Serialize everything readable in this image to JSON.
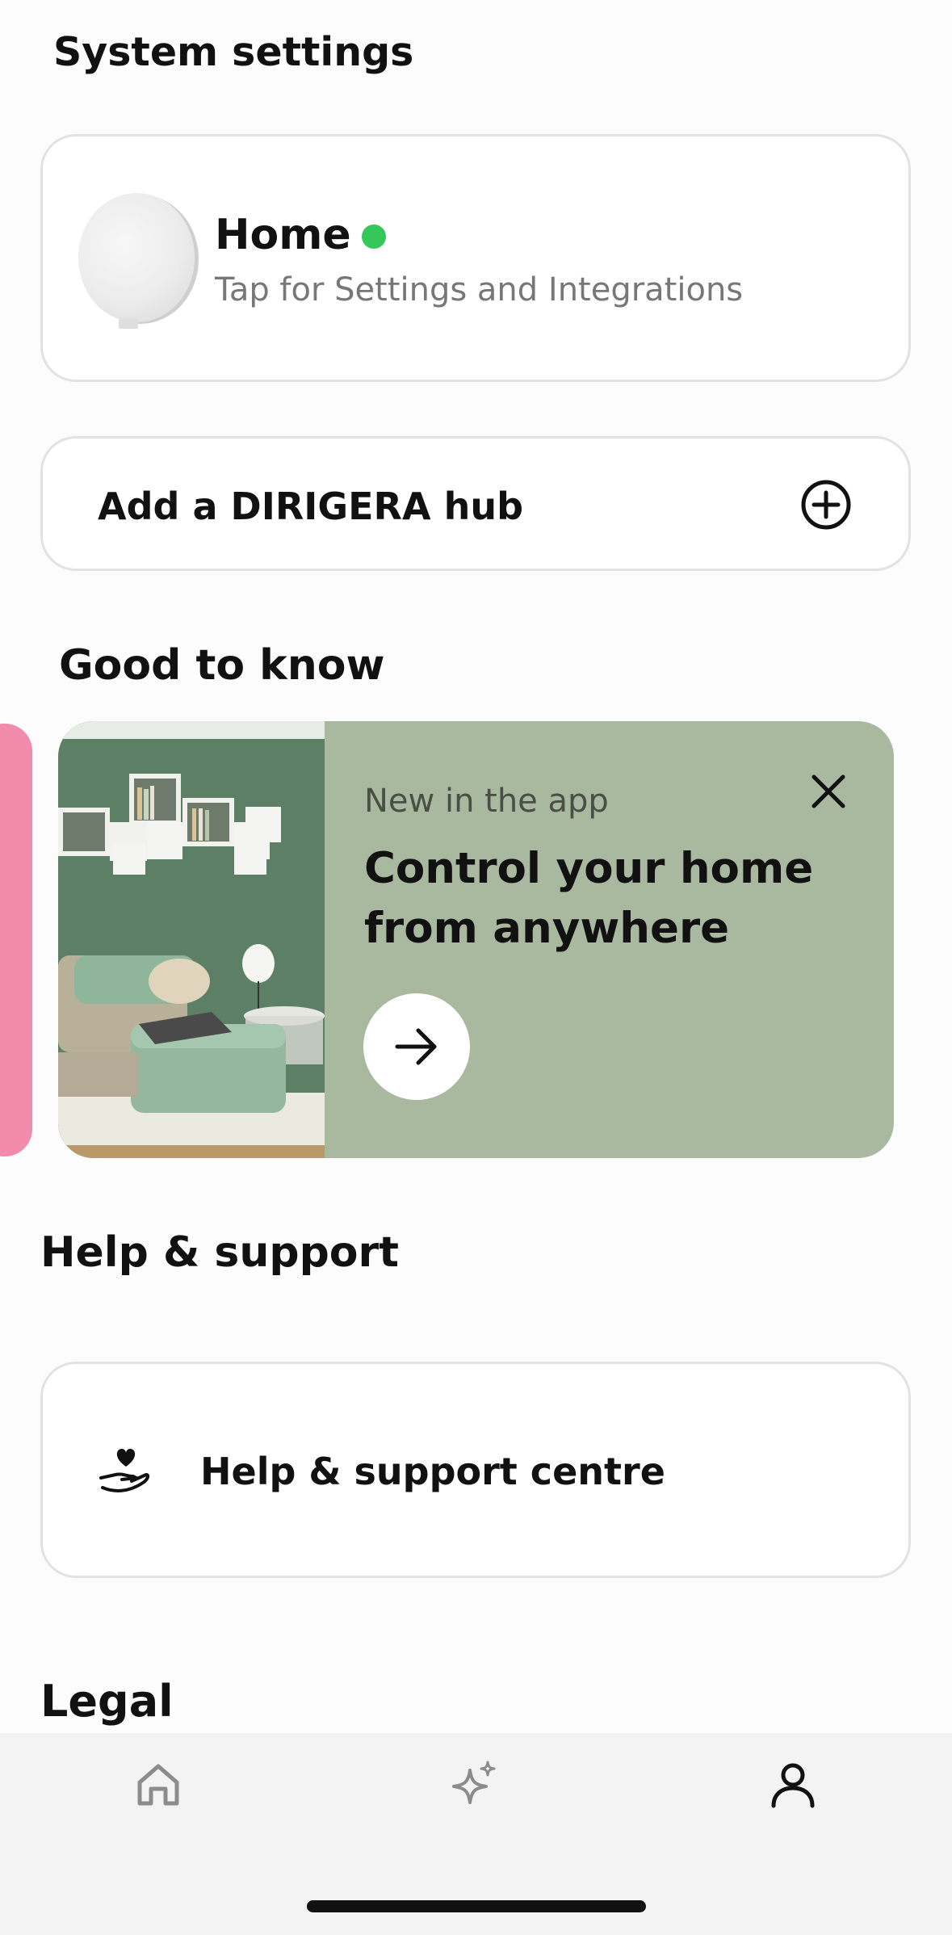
{
  "system_settings": {
    "title": "System settings",
    "hub": {
      "name": "Home",
      "status_color": "#34c759",
      "subtitle": "Tap for Settings and Integrations"
    },
    "add_hub": {
      "label": "Add a DIRIGERA hub",
      "icon": "plus-circle-icon"
    }
  },
  "good_to_know": {
    "title": "Good to know",
    "promo": {
      "kicker": "New in the app",
      "title": "Control your home from anywhere",
      "close_icon": "close-icon",
      "action_icon": "arrow-right-icon",
      "background_color": "#a8b9a0"
    },
    "next_card_color": "#f28aac"
  },
  "help_support": {
    "title": "Help & support",
    "item_label": "Help & support centre",
    "item_icon": "hand-heart-icon"
  },
  "legal": {
    "title": "Legal"
  },
  "tabbar": {
    "items": [
      {
        "icon": "home-icon",
        "selected": false
      },
      {
        "icon": "sparkle-icon",
        "selected": false
      },
      {
        "icon": "profile-icon",
        "selected": true
      }
    ]
  }
}
